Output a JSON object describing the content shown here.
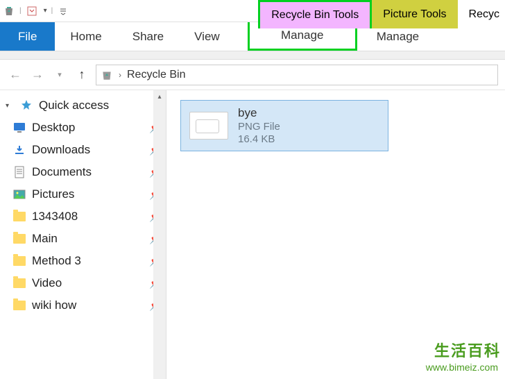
{
  "qat": {
    "items": [
      "recycle-bin",
      "properties",
      "dropdown"
    ]
  },
  "tools": {
    "recycle_bin": "Recycle Bin Tools",
    "picture": "Picture Tools",
    "window_title": "Recyc"
  },
  "ribbon": {
    "file": "File",
    "home": "Home",
    "share": "Share",
    "view": "View",
    "manage1": "Manage",
    "manage2": "Manage"
  },
  "breadcrumb": {
    "location": "Recycle Bin"
  },
  "sidebar": {
    "quick_access": "Quick access",
    "items": [
      {
        "label": "Desktop",
        "icon": "desktop",
        "pinned": true
      },
      {
        "label": "Downloads",
        "icon": "downloads",
        "pinned": true
      },
      {
        "label": "Documents",
        "icon": "documents",
        "pinned": true
      },
      {
        "label": "Pictures",
        "icon": "pictures",
        "pinned": true
      },
      {
        "label": "1343408",
        "icon": "folder",
        "pinned": true
      },
      {
        "label": "Main",
        "icon": "folder",
        "pinned": true
      },
      {
        "label": "Method 3",
        "icon": "folder",
        "pinned": true
      },
      {
        "label": "Video",
        "icon": "folder",
        "pinned": true
      },
      {
        "label": "wiki how",
        "icon": "folder",
        "pinned": true
      }
    ]
  },
  "file": {
    "name": "bye",
    "type": "PNG File",
    "size": "16.4 KB"
  },
  "watermark": {
    "text": "生活百科",
    "url": "www.bimeiz.com"
  }
}
